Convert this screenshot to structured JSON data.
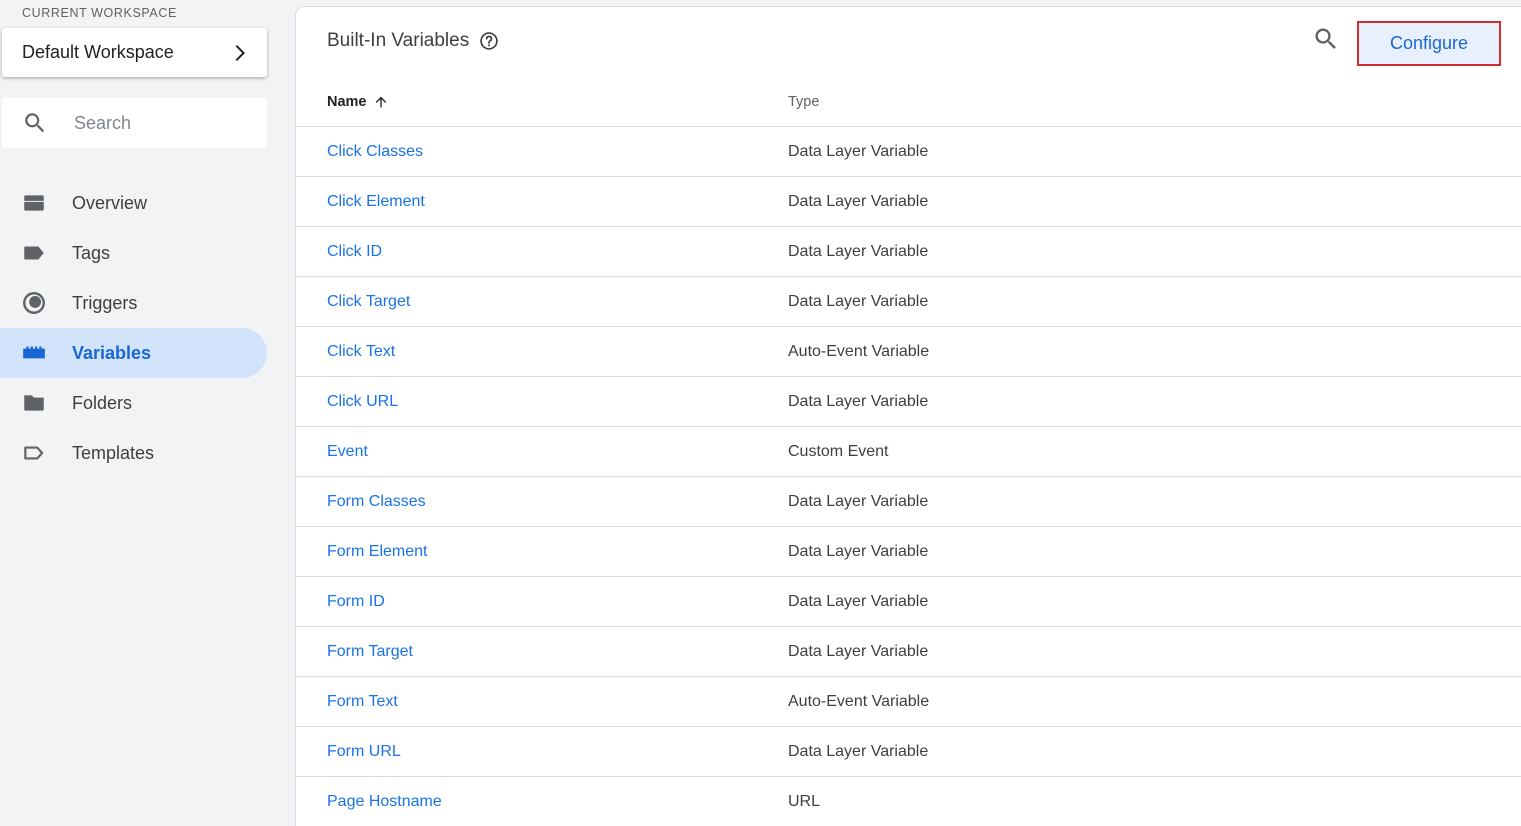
{
  "sidebar": {
    "workspace_label": "CURRENT WORKSPACE",
    "workspace_name": "Default Workspace",
    "search_placeholder": "Search",
    "nav": [
      {
        "label": "Overview",
        "icon": "overview-icon"
      },
      {
        "label": "Tags",
        "icon": "tag-icon"
      },
      {
        "label": "Triggers",
        "icon": "trigger-icon"
      },
      {
        "label": "Variables",
        "icon": "variables-icon",
        "active": true
      },
      {
        "label": "Folders",
        "icon": "folder-icon"
      },
      {
        "label": "Templates",
        "icon": "template-icon"
      }
    ]
  },
  "main": {
    "title": "Built-In Variables",
    "configure_label": "Configure",
    "columns": {
      "name": "Name",
      "type": "Type"
    },
    "rows": [
      {
        "name": "Click Classes",
        "type": "Data Layer Variable"
      },
      {
        "name": "Click Element",
        "type": "Data Layer Variable"
      },
      {
        "name": "Click ID",
        "type": "Data Layer Variable"
      },
      {
        "name": "Click Target",
        "type": "Data Layer Variable"
      },
      {
        "name": "Click Text",
        "type": "Auto-Event Variable"
      },
      {
        "name": "Click URL",
        "type": "Data Layer Variable"
      },
      {
        "name": "Event",
        "type": "Custom Event"
      },
      {
        "name": "Form Classes",
        "type": "Data Layer Variable"
      },
      {
        "name": "Form Element",
        "type": "Data Layer Variable"
      },
      {
        "name": "Form ID",
        "type": "Data Layer Variable"
      },
      {
        "name": "Form Target",
        "type": "Data Layer Variable"
      },
      {
        "name": "Form Text",
        "type": "Auto-Event Variable"
      },
      {
        "name": "Form URL",
        "type": "Data Layer Variable"
      },
      {
        "name": "Page Hostname",
        "type": "URL"
      }
    ]
  },
  "colors": {
    "accent": "#1a73e8",
    "active_bg": "#d2e3fc",
    "highlight_border": "#d32f2f"
  }
}
